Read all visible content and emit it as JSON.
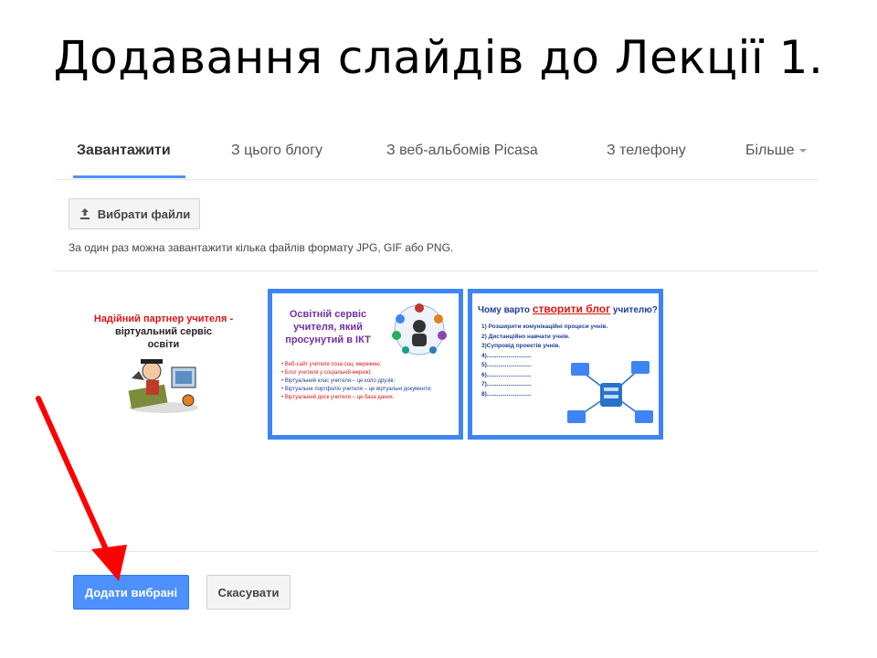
{
  "slide": {
    "title": "Додавання слайдів до Лекції 1."
  },
  "tabs": [
    {
      "label": "Завантажити",
      "active": true
    },
    {
      "label": "З цього блогу"
    },
    {
      "label": "З веб-альбомів Picasa"
    },
    {
      "label": "З телефону"
    },
    {
      "label": "Більше"
    }
  ],
  "upload": {
    "choose_label": "Вибрати файли",
    "hint": "За один раз можна завантажити кілька файлів формату JPG, GIF або PNG."
  },
  "thumbnails": {
    "t1": {
      "line1": "Надійний партнер учителя -",
      "line2": "віртуальний сервіс",
      "line3": "освіти"
    },
    "t2": {
      "title": "Освітній сервіс учителя, який просунутий в ІКТ",
      "items": [
        "Веб-сайт учителя поза соц. мережею;",
        "Блог учителя у соціальній мережі;",
        "Віртуальний клас учителя – це коло друзів;",
        "Віртуальне портфоліо учителя – це віртуальні документи;",
        "Віртуальний диск учителя – це база даних."
      ]
    },
    "t3": {
      "title_pre": "Чому варто",
      "title_hl": "створити блог",
      "title_post": "учителю?",
      "items": [
        "1) Розширити комунікаційні процеси учнів.",
        "2) Дистанційно навчати учнів.",
        "3)Супровід проектів учнів.",
        "4)...........................",
        "5)...........................",
        "6)...........................",
        "7)...........................",
        "8)..........................."
      ]
    }
  },
  "actions": {
    "add_label": "Додати вибрані",
    "cancel_label": "Скасувати"
  },
  "colors": {
    "accent": "#4d90fe",
    "arrow": "#ff0000",
    "thumb_border": "#3d85f5"
  }
}
